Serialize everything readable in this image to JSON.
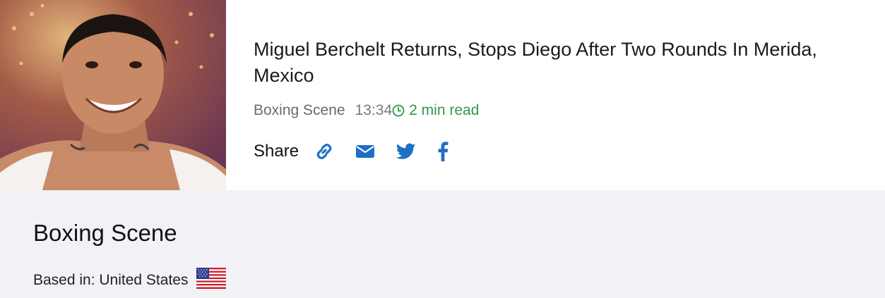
{
  "article": {
    "headline": "Miguel Berchelt Returns, Stops Diego After Two Rounds In Merida, Mexico",
    "source": "Boxing Scene",
    "time": "13:34",
    "read_time": "2 min read",
    "share_label": "Share",
    "share_icons": [
      "link-icon",
      "envelope-icon",
      "twitter-icon",
      "facebook-icon"
    ]
  },
  "publisher": {
    "name": "Boxing Scene",
    "based_in": "Based in: United States",
    "flag_icon": "us-flag-icon"
  },
  "colors": {
    "accent_blue": "#1f6fc4",
    "read_green": "#2e9a4a",
    "panel_bg": "#f2f1f6"
  }
}
